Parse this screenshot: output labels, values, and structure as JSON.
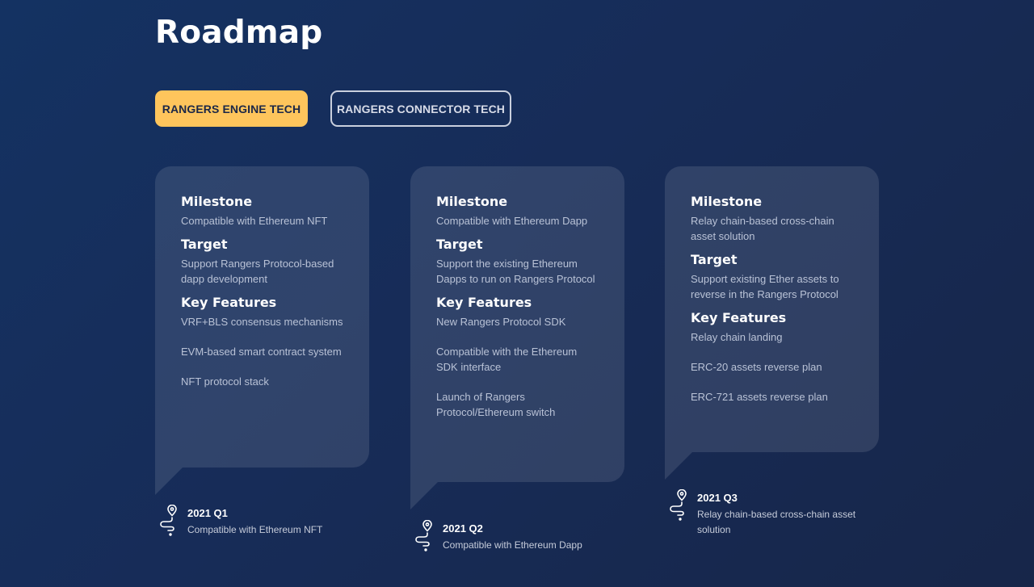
{
  "page": {
    "title": "Roadmap"
  },
  "tabs": [
    {
      "label": "RANGERS ENGINE TECH",
      "active": true
    },
    {
      "label": "RANGERS CONNECTOR TECH",
      "active": false
    }
  ],
  "colors": {
    "accent": "#fec55c",
    "background": "#172c58",
    "card": "#2d4064"
  },
  "cards": [
    {
      "milestone_title": "Milestone",
      "milestone": "Compatible with Ethereum NFT",
      "target_title": "Target",
      "target": "Support Rangers Protocol-based dapp development",
      "features_title": "Key Features",
      "features": [
        "VRF+BLS consensus mechanisms",
        "EVM-based smart contract system",
        "NFT protocol stack"
      ],
      "quarter": "2021 Q1",
      "quarter_desc": "Compatible with Ethereum NFT",
      "icon": "location-path-icon"
    },
    {
      "milestone_title": "Milestone",
      "milestone": "Compatible with Ethereum Dapp",
      "target_title": "Target",
      "target": "Support the existing Ethereum Dapps to run on Rangers Protocol",
      "features_title": "Key Features",
      "features": [
        "New Rangers Protocol SDK",
        "Compatible with the Ethereum SDK interface",
        "Launch of Rangers Protocol/Ethereum switch"
      ],
      "quarter": "2021 Q2",
      "quarter_desc": "Compatible with Ethereum Dapp",
      "icon": "location-path-icon"
    },
    {
      "milestone_title": "Milestone",
      "milestone": "Relay chain-based cross-chain asset solution",
      "target_title": "Target",
      "target": "Support existing Ether assets to reverse in the Rangers Protocol",
      "features_title": "Key Features",
      "features": [
        "Relay chain landing",
        "ERC-20 assets reverse plan",
        "ERC-721 assets reverse plan"
      ],
      "quarter": "2021 Q3",
      "quarter_desc": "Relay chain-based cross-chain asset solution",
      "icon": "location-path-icon"
    }
  ]
}
